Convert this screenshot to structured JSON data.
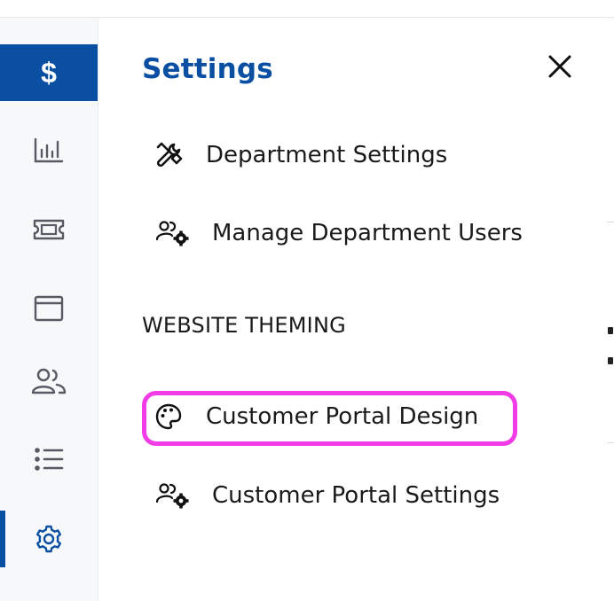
{
  "rail": {
    "items": [
      {
        "name": "billing",
        "icon": "dollar-icon",
        "glyph": "$",
        "active": true
      },
      {
        "name": "analytics",
        "icon": "bar-chart-icon"
      },
      {
        "name": "tickets",
        "icon": "ticket-icon"
      },
      {
        "name": "window",
        "icon": "browser-window-icon"
      },
      {
        "name": "users",
        "icon": "users-icon"
      },
      {
        "name": "list",
        "icon": "list-icon"
      },
      {
        "name": "settings",
        "icon": "gear-icon",
        "selected": true
      }
    ]
  },
  "settings_panel": {
    "title": "Settings",
    "close_icon": "close-icon",
    "items": [
      {
        "label": "Department Settings",
        "icon": "tools-icon"
      },
      {
        "label": "Manage Department Users",
        "icon": "users-gear-icon"
      }
    ],
    "section_heading": "WEBSITE THEMING",
    "theming_items": [
      {
        "label": "Customer Portal Design",
        "icon": "palette-icon",
        "highlighted": true
      },
      {
        "label": "Customer Portal Settings",
        "icon": "users-gear-icon"
      }
    ]
  },
  "colors": {
    "accent": "#0b4fa3",
    "highlight": "#f23ce8",
    "rail_background": "#f7f8fa",
    "icon_gray": "#555a63"
  }
}
